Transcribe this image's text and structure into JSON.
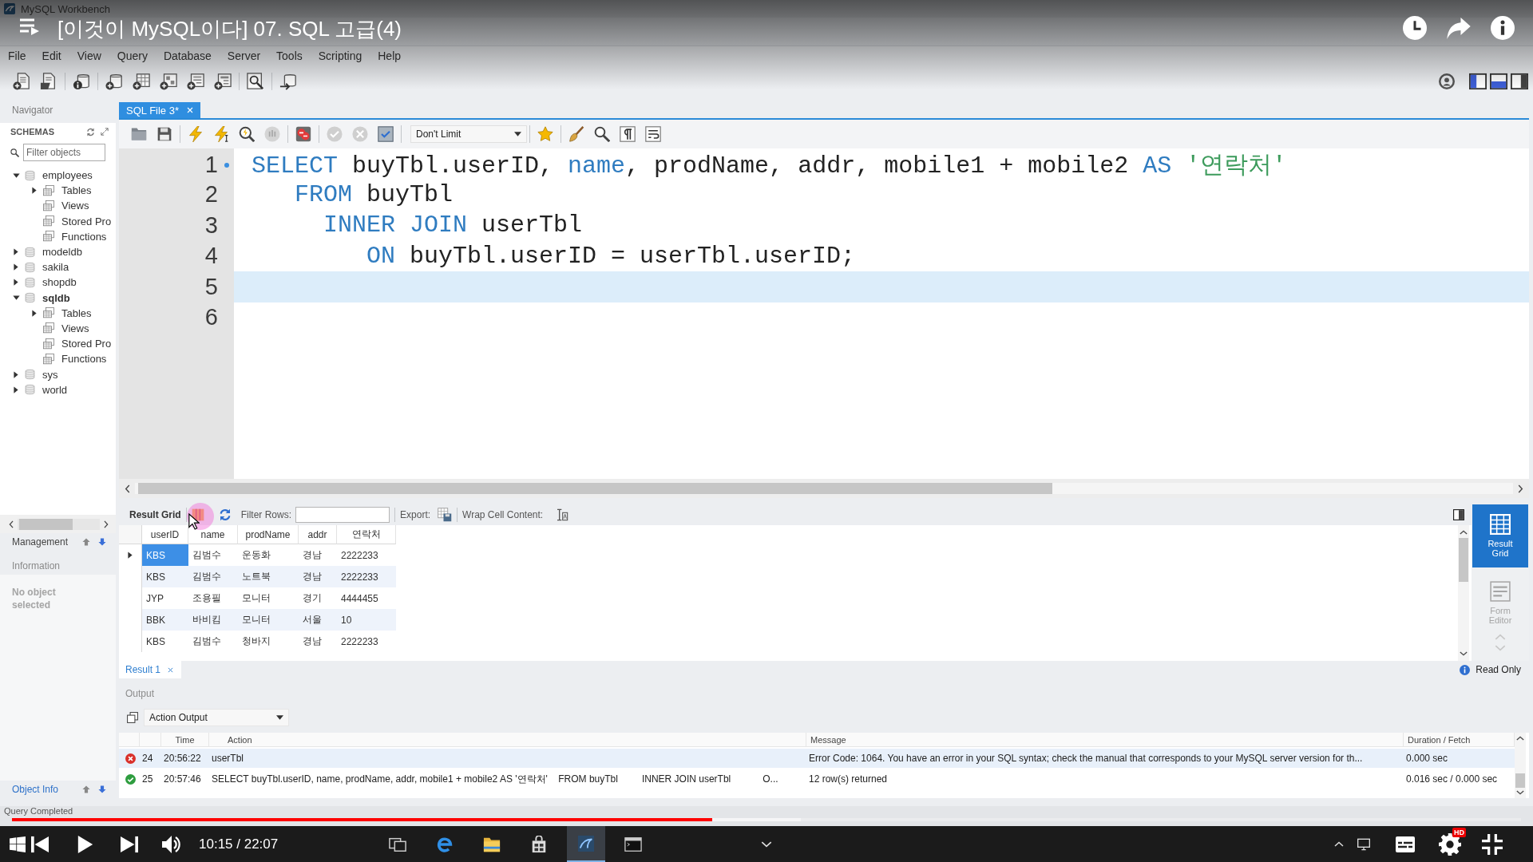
{
  "window": {
    "title": "MySQL Workbench"
  },
  "menu": [
    "File",
    "Edit",
    "View",
    "Query",
    "Database",
    "Server",
    "Tools",
    "Scripting",
    "Help"
  ],
  "navigator": {
    "title": "Navigator",
    "section": "SCHEMAS",
    "filter": {
      "placeholder": "Filter objects"
    },
    "schemas": [
      {
        "label": "employees",
        "expanded": true,
        "default": false,
        "children": [
          {
            "label": "Tables",
            "kind": "group",
            "expanded": false
          },
          {
            "label": "Views",
            "kind": "leaf"
          },
          {
            "label": "Stored Pro",
            "kind": "leaf"
          },
          {
            "label": "Functions",
            "kind": "leaf"
          }
        ]
      },
      {
        "label": "modeldb",
        "expanded": false,
        "default": false
      },
      {
        "label": "sakila",
        "expanded": false,
        "default": false
      },
      {
        "label": "shopdb",
        "expanded": false,
        "default": false
      },
      {
        "label": "sqldb",
        "expanded": true,
        "default": true,
        "children": [
          {
            "label": "Tables",
            "kind": "group",
            "expanded": false
          },
          {
            "label": "Views",
            "kind": "leaf"
          },
          {
            "label": "Stored Pro",
            "kind": "leaf"
          },
          {
            "label": "Functions",
            "kind": "leaf"
          }
        ]
      },
      {
        "label": "sys",
        "expanded": false,
        "default": false
      },
      {
        "label": "world",
        "expanded": false,
        "default": false
      }
    ]
  },
  "management": {
    "label": "Management"
  },
  "information": {
    "title": "Information",
    "text": "No object selected"
  },
  "info_tabs": [
    {
      "label": "Object Info",
      "selected": true
    }
  ],
  "editor": {
    "tab": {
      "label": "SQL File 3*",
      "selected": true
    },
    "limit": "Don't Limit",
    "lines": [
      {
        "number": "1",
        "statement_start": true,
        "current": false,
        "tokens": [
          {
            "kind": "keyword",
            "text": "SELECT"
          },
          {
            "kind": "plain",
            "text": " buyTbl.userID, "
          },
          {
            "kind": "keyword",
            "text": "name"
          },
          {
            "kind": "plain",
            "text": ", prodName, addr, mobile1 + mobile2 "
          },
          {
            "kind": "keyword",
            "text": "AS "
          },
          {
            "kind": "string",
            "text": "'연락처'"
          }
        ]
      },
      {
        "number": "2",
        "statement_start": false,
        "current": false,
        "tokens": [
          {
            "kind": "keyword",
            "text": "   FROM"
          },
          {
            "kind": "plain",
            "text": " buyTbl"
          }
        ]
      },
      {
        "number": "3",
        "statement_start": false,
        "current": false,
        "tokens": [
          {
            "kind": "keyword",
            "text": "     INNER JOIN"
          },
          {
            "kind": "plain",
            "text": " userTbl"
          }
        ]
      },
      {
        "number": "4",
        "statement_start": false,
        "current": false,
        "tokens": [
          {
            "kind": "keyword",
            "text": "        ON"
          },
          {
            "kind": "plain",
            "text": " buyTbl.userID = userTbl.userID;"
          }
        ]
      },
      {
        "number": "5",
        "statement_start": false,
        "current": true
      },
      {
        "number": "6",
        "statement_start": false,
        "current": false
      }
    ]
  },
  "results": {
    "view_label": "Result Grid",
    "filter_label": "Filter Rows:",
    "export_label": "Export:",
    "wrap_label": "Wrap Cell Content:",
    "columns": [
      "userID",
      "name",
      "prodName",
      "addr",
      "연락처"
    ],
    "rows": [
      {
        "selected": true,
        "cells": [
          "KBS",
          "김범수",
          "운동화",
          "경남",
          "2222233"
        ]
      },
      {
        "selected": false,
        "cells": [
          "KBS",
          "김범수",
          "노트북",
          "경남",
          "2222233"
        ]
      },
      {
        "selected": false,
        "cells": [
          "JYP",
          "조용필",
          "모니터",
          "경기",
          "4444455"
        ]
      },
      {
        "selected": false,
        "cells": [
          "BBK",
          "바비킴",
          "모니터",
          "서울",
          "10"
        ]
      },
      {
        "selected": false,
        "cells": [
          "KBS",
          "김범수",
          "청바지",
          "경남",
          "2222233"
        ]
      }
    ],
    "side_views": [
      {
        "label": "Result Grid",
        "kind": "grid",
        "selected": true
      },
      {
        "label": "Form Editor",
        "kind": "form",
        "selected": false
      }
    ],
    "tab": {
      "label": "Result 1",
      "selected": true
    },
    "read_only": "Read Only"
  },
  "output": {
    "title": "Output",
    "selector": "Action Output",
    "columns": [
      "Time",
      "Action",
      "Message",
      "Duration / Fetch"
    ],
    "rows": [
      {
        "kind": "error",
        "selected": true,
        "number": "24",
        "time": "20:56:22",
        "action": "userTbl",
        "message": "Error Code: 1064. You have an error in your SQL syntax; check the manual that corresponds to your MySQL server version for th...",
        "duration": "0.000 sec"
      },
      {
        "kind": "success",
        "selected": false,
        "number": "25",
        "time": "20:57:46",
        "action": "SELECT buyTbl.userID, name, prodName, addr, mobile1 + mobile2 AS '연락처'    FROM buyTbl         INNER JOIN userTbl            O...",
        "message": "12 row(s) returned",
        "duration": "0.016 sec / 0.000 sec"
      }
    ]
  },
  "status_bar": {
    "text": "Query Completed"
  },
  "taskbar": {
    "apps": [
      {
        "kind": "task_view",
        "selected": false
      },
      {
        "kind": "browser",
        "selected": false
      },
      {
        "kind": "files",
        "selected": false
      },
      {
        "kind": "store",
        "selected": false
      },
      {
        "kind": "workbench",
        "selected": true
      },
      {
        "kind": "terminal",
        "selected": false
      }
    ]
  },
  "player": {
    "title": "[이것이 MySQL이다] 07. SQL 고급(4)",
    "progress": {
      "level": 0.464
    },
    "buffered": {
      "level": 0.523
    },
    "time": "10:15 / 22:07",
    "quality_badge": "HD"
  }
}
